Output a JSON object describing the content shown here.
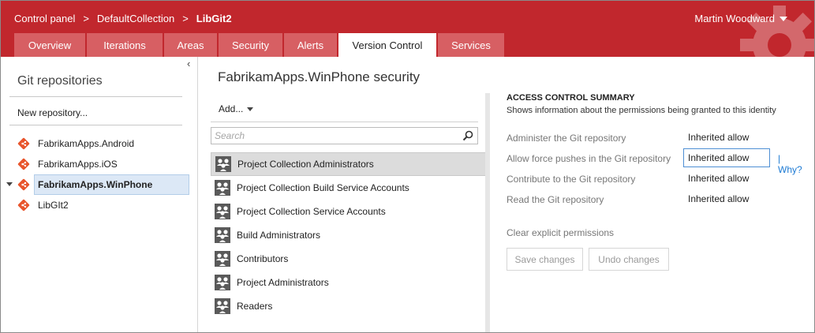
{
  "header": {
    "breadcrumb": [
      "Control panel",
      "DefaultCollection",
      "LibGit2"
    ],
    "separator": ">",
    "user": "Martin Woodward",
    "tabs": [
      {
        "label": "Overview",
        "active": false
      },
      {
        "label": "Iterations",
        "active": false
      },
      {
        "label": "Areas",
        "active": false
      },
      {
        "label": "Security",
        "active": false
      },
      {
        "label": "Alerts",
        "active": false
      },
      {
        "label": "Version Control",
        "active": true
      },
      {
        "label": "Services",
        "active": false
      }
    ],
    "colors": {
      "bar": "#c1272d",
      "tab": "#d75f63"
    }
  },
  "left_panel": {
    "collapse_glyph": "‹",
    "title": "Git repositories",
    "new_repo": "New repository...",
    "repos": [
      {
        "label": "FabrikamApps.Android",
        "selected": false,
        "icon": "git-repo-icon"
      },
      {
        "label": "FabrikamApps.iOS",
        "selected": false,
        "icon": "git-repo-icon"
      },
      {
        "label": "FabrikamApps.WinPhone",
        "selected": true,
        "icon": "git-repo-icon"
      },
      {
        "label": "LibGIt2",
        "selected": false,
        "icon": "git-repo-icon"
      }
    ]
  },
  "main": {
    "title": "FabrikamApps.WinPhone security",
    "add_label": "Add...",
    "search_placeholder": "Search",
    "groups": [
      {
        "label": "Project Collection Administrators",
        "selected": true
      },
      {
        "label": "Project Collection Build Service Accounts",
        "selected": false
      },
      {
        "label": "Project Collection Service Accounts",
        "selected": false
      },
      {
        "label": "Build Administrators",
        "selected": false
      },
      {
        "label": "Contributors",
        "selected": false
      },
      {
        "label": "Project Administrators",
        "selected": false
      },
      {
        "label": "Readers",
        "selected": false
      }
    ]
  },
  "access_control": {
    "title": "ACCESS CONTROL SUMMARY",
    "subtitle": "Shows information about the permissions being granted to this identity",
    "permissions": [
      {
        "name": "Administer the Git repository",
        "value": "Inherited allow"
      },
      {
        "name": "Allow force pushes in the Git repository",
        "value": "Inherited allow",
        "focused": true,
        "why": "| Why?"
      },
      {
        "name": "Contribute to the Git repository",
        "value": "Inherited allow"
      },
      {
        "name": "Read the Git repository",
        "value": "Inherited allow"
      }
    ],
    "clear_label": "Clear explicit permissions",
    "save_label": "Save changes",
    "undo_label": "Undo changes",
    "link_color": "#1e7bd4"
  }
}
